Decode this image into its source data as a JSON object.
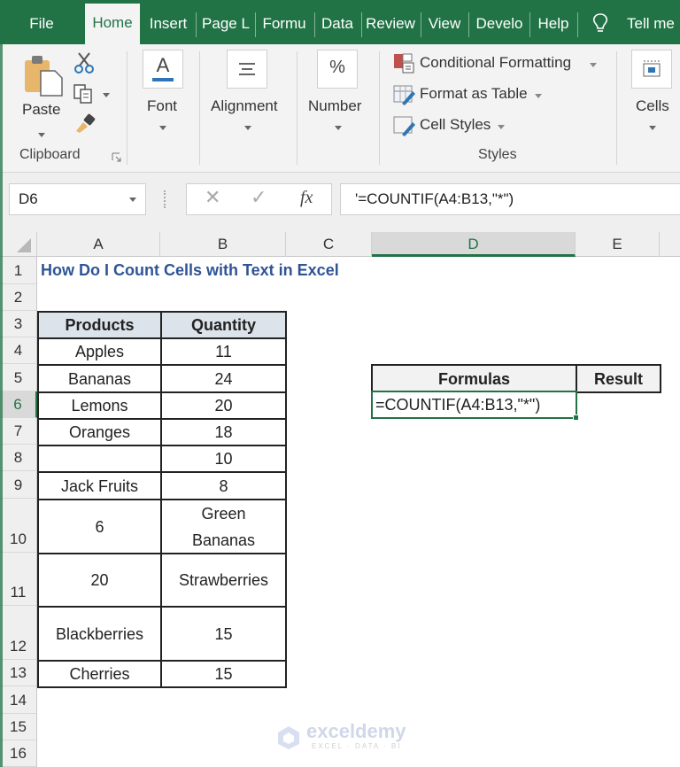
{
  "tabs": [
    {
      "label": "File",
      "active": false
    },
    {
      "label": "Home",
      "active": true
    },
    {
      "label": "Insert",
      "active": false
    },
    {
      "label": "Page L",
      "active": false
    },
    {
      "label": "Formu",
      "active": false
    },
    {
      "label": "Data",
      "active": false
    },
    {
      "label": "Review",
      "active": false
    },
    {
      "label": "View",
      "active": false
    },
    {
      "label": "Develo",
      "active": false
    },
    {
      "label": "Help",
      "active": false
    }
  ],
  "tell_me": "Tell me",
  "ribbon": {
    "clipboard": {
      "paste": "Paste",
      "group": "Clipboard"
    },
    "font": "Font",
    "alignment": "Alignment",
    "number": "Number",
    "number_glyph": "%",
    "font_glyph": "A",
    "styles": {
      "conditional_formatting": "Conditional Formatting",
      "format_as_table": "Format as Table",
      "cell_styles": "Cell Styles",
      "group": "Styles"
    },
    "cells": "Cells"
  },
  "formula_bar": {
    "name_box": "D6",
    "cancel_glyph": "✕",
    "enter_glyph": "✓",
    "fx": "fx",
    "content": "'=COUNTIF(A4:B13,\"*\")"
  },
  "columns": [
    "A",
    "B",
    "C",
    "D",
    "E"
  ],
  "selected_column": "D",
  "rows": [
    "1",
    "2",
    "3",
    "4",
    "5",
    "6",
    "7",
    "8",
    "9",
    "10",
    "11",
    "12",
    "13",
    "14",
    "15",
    "16"
  ],
  "selected_row": "6",
  "sheet": {
    "title": "How Do I Count Cells with Text in Excel",
    "table": {
      "headers": [
        "Products",
        "Quantity"
      ],
      "rows": [
        [
          "Apples",
          "11"
        ],
        [
          "Bananas",
          "24"
        ],
        [
          "Lemons",
          "20"
        ],
        [
          "Oranges",
          "18"
        ],
        [
          "",
          "10"
        ],
        [
          "Jack Fruits",
          "8"
        ],
        [
          "6",
          "Green Bananas"
        ],
        [
          "20",
          "Strawberries"
        ],
        [
          "Blackberries",
          "15"
        ],
        [
          "Cherries",
          "15"
        ]
      ]
    },
    "formula_table": {
      "headers": [
        "Formulas",
        "Result"
      ],
      "formula": "=COUNTIF(A4:B13,\"*\")",
      "result": ""
    }
  },
  "watermark": {
    "name": "exceldemy",
    "tagline": "EXCEL · DATA · BI"
  },
  "colors": {
    "accent": "#217346",
    "title": "#2f5496",
    "header_fill": "#dce3ea"
  }
}
